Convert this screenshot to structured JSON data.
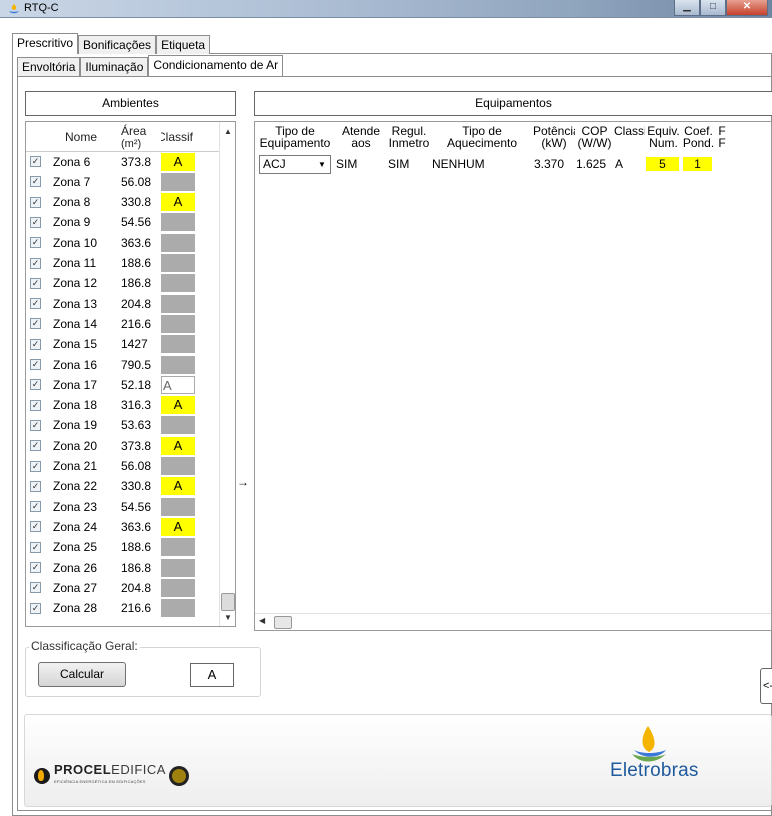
{
  "window": {
    "title": "RTQ-C"
  },
  "tabs_main": [
    {
      "label": "Prescritivo",
      "active": true
    },
    {
      "label": "Bonificações",
      "active": false
    },
    {
      "label": "Etiqueta",
      "active": false
    }
  ],
  "tabs_sub": [
    {
      "label": "Envoltória",
      "active": false
    },
    {
      "label": "Iluminação",
      "active": false
    },
    {
      "label": "Condicionamento de Ar",
      "active": true
    }
  ],
  "ambientes": {
    "title": "Ambientes",
    "headers": {
      "nome": "Nome",
      "area1": "Área",
      "area2": "(m²)",
      "classif": "Classif"
    },
    "rows": [
      {
        "nome": "Zona 6",
        "area": "373.8",
        "classif": "A",
        "style": "yellow"
      },
      {
        "nome": "Zona 7",
        "area": "56.08",
        "classif": "",
        "style": "gray"
      },
      {
        "nome": "Zona 8",
        "area": "330.8",
        "classif": "A",
        "style": "yellow"
      },
      {
        "nome": "Zona 9",
        "area": "54.56",
        "classif": "",
        "style": "gray"
      },
      {
        "nome": "Zona 10",
        "area": "363.6",
        "classif": "",
        "style": "gray"
      },
      {
        "nome": "Zona 11",
        "area": "188.6",
        "classif": "",
        "style": "gray"
      },
      {
        "nome": "Zona 12",
        "area": "186.8",
        "classif": "",
        "style": "gray"
      },
      {
        "nome": "Zona 13",
        "area": "204.8",
        "classif": "",
        "style": "gray"
      },
      {
        "nome": "Zona 14",
        "area": "216.6",
        "classif": "",
        "style": "gray"
      },
      {
        "nome": "Zona 15",
        "area": "1427",
        "classif": "",
        "style": "gray"
      },
      {
        "nome": "Zona 16",
        "area": "790.5",
        "classif": "",
        "style": "gray"
      },
      {
        "nome": "Zona 17",
        "area": "52.18",
        "classif": "A",
        "style": "white"
      },
      {
        "nome": "Zona 18",
        "area": "316.3",
        "classif": "A",
        "style": "yellow"
      },
      {
        "nome": "Zona 19",
        "area": "53.63",
        "classif": "",
        "style": "gray"
      },
      {
        "nome": "Zona 20",
        "area": "373.8",
        "classif": "A",
        "style": "yellow"
      },
      {
        "nome": "Zona 21",
        "area": "56.08",
        "classif": "",
        "style": "gray"
      },
      {
        "nome": "Zona 22",
        "area": "330.8",
        "classif": "A",
        "style": "yellow"
      },
      {
        "nome": "Zona 23",
        "area": "54.56",
        "classif": "",
        "style": "gray"
      },
      {
        "nome": "Zona 24",
        "area": "363.6",
        "classif": "A",
        "style": "yellow"
      },
      {
        "nome": "Zona 25",
        "area": "188.6",
        "classif": "",
        "style": "gray"
      },
      {
        "nome": "Zona 26",
        "area": "186.8",
        "classif": "",
        "style": "gray"
      },
      {
        "nome": "Zona 27",
        "area": "204.8",
        "classif": "",
        "style": "gray"
      },
      {
        "nome": "Zona 28",
        "area": "216.6",
        "classif": "",
        "style": "gray"
      }
    ]
  },
  "equipamentos": {
    "title": "Equipamentos",
    "headers": [
      {
        "l1": "Tipo de",
        "l2": "Equipamento"
      },
      {
        "l1": "Atende",
        "l2": "aos"
      },
      {
        "l1": "Regul.",
        "l2": "Inmetro"
      },
      {
        "l1": "Tipo de",
        "l2": "Aquecimento"
      },
      {
        "l1": "Potência",
        "l2": "(kW)"
      },
      {
        "l1": "COP",
        "l2": "(W/W)"
      },
      {
        "l1": "Classif",
        "l2": ""
      },
      {
        "l1": "Equiv.",
        "l2": "Num."
      },
      {
        "l1": "Coef.",
        "l2": "Pond."
      },
      {
        "l1": "F",
        "l2": "F"
      }
    ],
    "row": {
      "tipo": "ACJ",
      "atende": "SIM",
      "regul": "SIM",
      "aquecimento": "NENHUM",
      "potencia": "3.370",
      "cop": "1.625",
      "classif": "A",
      "equiv": "5",
      "coef": "1"
    }
  },
  "mid_arrow": "→",
  "classificacao": {
    "label": "Classificação Geral:",
    "button": "Calcular",
    "result": "A"
  },
  "side_button": "<-",
  "footer": {
    "procel_bold": "PROCEL",
    "procel_rest": "EDIFICA",
    "procel_sub": "EFICIÊNCIA ENERGÉTICA EM EDIFICAÇÕES",
    "eletrobras": "Eletrobras"
  },
  "colors": {
    "yellow": "#ffff00",
    "gray": "#ababab",
    "eletrobras_blue": "#1f5a9e",
    "eletrobras_yellow": "#f4b400",
    "eletrobras_green": "#6aa84f"
  }
}
